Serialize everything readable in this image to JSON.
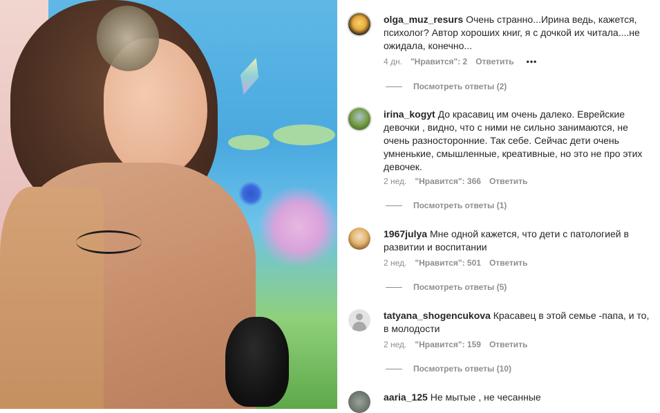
{
  "comments": [
    {
      "username": "olga_muz_resurs",
      "text": "Очень странно...Ирина ведь, кажется, психолог? Автор хороших книг, я с дочкой их читала....не ожидала, конечно...",
      "time": "4 дн.",
      "likes": "\"Нравится\": 2",
      "reply": "Ответить",
      "more": "•••",
      "view_replies": "Посмотреть ответы (2)",
      "avatar_icon": "user-avatar-photo"
    },
    {
      "username": "irina_kogyt",
      "text": "До красавиц им очень далеко. Еврейские девочки , видно, что с ними не сильно занимаются, не очень разносторонние. Так себе. Сейчас дети очень умненькие, смышленные, креативные, но это не про этих девочек.",
      "time": "2 нед.",
      "likes": "\"Нравится\": 366",
      "reply": "Ответить",
      "view_replies": "Посмотреть ответы (1)",
      "avatar_icon": "user-avatar-photo"
    },
    {
      "username": "1967julya",
      "text": "Мне одной кажется, что дети с патологией в развитии и воспитании",
      "time": "2 нед.",
      "likes": "\"Нравится\": 501",
      "reply": "Ответить",
      "view_replies": "Посмотреть ответы (5)",
      "avatar_icon": "user-avatar-photo"
    },
    {
      "username": "tatyana_shogencukova",
      "text": "Красавец в этой семье -папа, и то, в молодости",
      "time": "2 нед.",
      "likes": "\"Нравится\": 159",
      "reply": "Ответить",
      "view_replies": "Посмотреть ответы (10)",
      "avatar_icon": "default-user-icon"
    },
    {
      "username": "aaria_125",
      "text": "Не мытые , не чесанные",
      "avatar_icon": "user-avatar-photo"
    }
  ]
}
